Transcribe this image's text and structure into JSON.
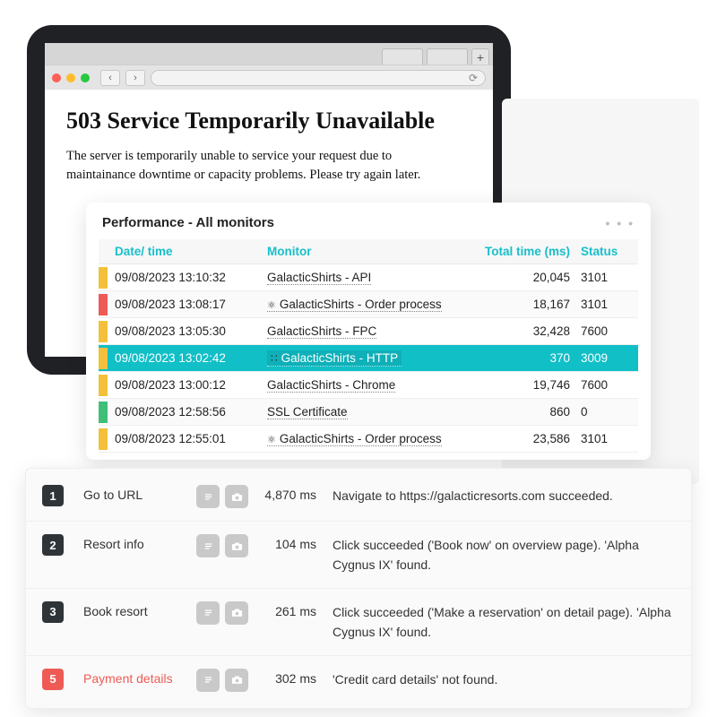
{
  "browser": {
    "error_title": "503 Service Temporarily Unavailable",
    "error_body": "The server is temporarily unable to service your request due to maintainance downtime or capacity problems. Please try again later.",
    "reload_glyph": "⟳",
    "add_tab_glyph": "+",
    "back_glyph": "‹",
    "fwd_glyph": "›"
  },
  "perf": {
    "title": "Performance - All monitors",
    "menu_glyph": "• • •",
    "columns": {
      "dt": "Date/ time",
      "mon": "Monitor",
      "tt": "Total time (ms)",
      "st": "Status"
    },
    "rows": [
      {
        "color": "c-yel",
        "dt": "09/08/2023 13:10:32",
        "icon": "",
        "mon": "GalacticShirts - API",
        "tt": "20,045",
        "st": "3101",
        "hl": false
      },
      {
        "color": "c-red",
        "dt": "09/08/2023 13:08:17",
        "icon": "flask",
        "mon": "GalacticShirts - Order process",
        "tt": "18,167",
        "st": "3101",
        "hl": false
      },
      {
        "color": "c-yel",
        "dt": "09/08/2023 13:05:30",
        "icon": "",
        "mon": "GalacticShirts - FPC",
        "tt": "32,428",
        "st": "7600",
        "hl": false
      },
      {
        "color": "c-yel",
        "dt": "09/08/2023 13:02:42",
        "icon": "grip",
        "mon": "GalacticShirts - HTTP",
        "tt": "370",
        "st": "3009",
        "hl": true
      },
      {
        "color": "c-yel",
        "dt": "09/08/2023 13:00:12",
        "icon": "",
        "mon": "GalacticShirts - Chrome",
        "tt": "19,746",
        "st": "7600",
        "hl": false
      },
      {
        "color": "c-grn",
        "dt": "09/08/2023 12:58:56",
        "icon": "",
        "mon": "SSL Certificate",
        "tt": "860",
        "st": "0",
        "hl": false
      },
      {
        "color": "c-yel",
        "dt": "09/08/2023 12:55:01",
        "icon": "flask",
        "mon": "GalacticShirts - Order process",
        "tt": "23,586",
        "st": "3101",
        "hl": false
      }
    ]
  },
  "steps": [
    {
      "n": "1",
      "name": "Go to URL",
      "dur": "4,870 ms",
      "desc": "Navigate to https://galacticresorts.com succeeded.",
      "err": false
    },
    {
      "n": "2",
      "name": "Resort info",
      "dur": "104 ms",
      "desc": "Click succeeded ('Book now' on overview page). 'Alpha Cygnus IX' found.",
      "err": false
    },
    {
      "n": "3",
      "name": "Book resort",
      "dur": "261 ms",
      "desc": "Click succeeded ('Make a reservation' on detail page). 'Alpha Cygnus IX' found.",
      "err": false
    },
    {
      "n": "5",
      "name": "Payment details",
      "dur": "302 ms",
      "desc": "'Credit card details' not found.",
      "err": true
    }
  ]
}
